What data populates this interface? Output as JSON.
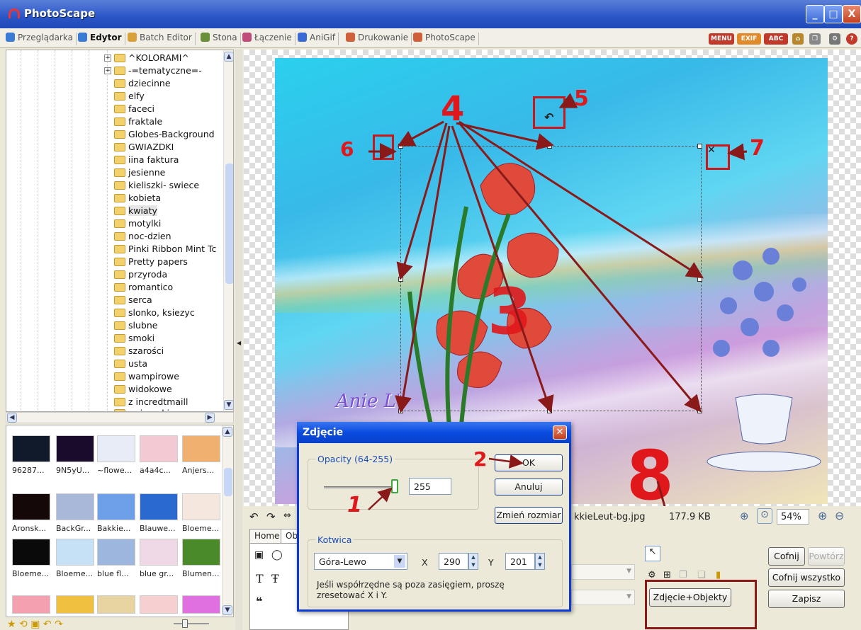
{
  "app": {
    "title": "PhotoScape"
  },
  "window_buttons": {
    "minimize": "_",
    "maximize": "□",
    "close": "X"
  },
  "tabs": [
    {
      "label": "Przeglądarka",
      "color": "#3a7bd5"
    },
    {
      "label": "Edytor",
      "color": "#3a7bd5"
    },
    {
      "label": "Batch Editor",
      "color": "#d9a13a"
    },
    {
      "label": "Stona",
      "color": "#6a8f3a"
    },
    {
      "label": "Łączenie",
      "color": "#c04a7a"
    },
    {
      "label": "AniGif",
      "color": "#3a6ad5"
    },
    {
      "label": "Drukowanie",
      "color": "#d0603a"
    },
    {
      "label": "PhotoScape",
      "color": "#d0603a"
    }
  ],
  "top_right_icons": {
    "menu": "MENU",
    "exif": "EXIF",
    "abc": "ABC"
  },
  "folders": [
    "^KOLORAMI^",
    "-=tematyczne=-",
    "dziecinne",
    "elfy",
    "faceci",
    "fraktale",
    "Globes-Background",
    "GWIAZDKI",
    "iina faktura",
    "jesienne",
    "kieliszki- swiece",
    "kobieta",
    "kwiaty",
    "motylki",
    "noc-dzien",
    "Pinki Ribbon Mint Tc",
    "Pretty papers",
    "przyroda",
    "romantico",
    "serca",
    "slonko, ksiezyc",
    "slubne",
    "smoki",
    "szarości",
    "usta",
    "wampirowe",
    "widokowe",
    "z incredtmaill",
    "zwierzaki"
  ],
  "selected_folder": "kwiaty",
  "thumbnails": [
    {
      "label": "96287...",
      "color": "#111a2a"
    },
    {
      "label": "9N5yU...",
      "color": "#1a0b2a"
    },
    {
      "label": "~flowe...",
      "color": "#e8ecf6"
    },
    {
      "label": "a4a4c...",
      "color": "#f3c9d4"
    },
    {
      "label": "Anjers...",
      "color": "#f0b070"
    },
    {
      "label": "Aronsk...",
      "color": "#140808"
    },
    {
      "label": "BackGr...",
      "color": "#a9b8d8"
    },
    {
      "label": "Bakkie...",
      "color": "#6da0e8"
    },
    {
      "label": "Blauwe...",
      "color": "#2a6ad0"
    },
    {
      "label": "Bloeme...",
      "color": "#f5e6de"
    },
    {
      "label": "Bloeme...",
      "color": "#0a0a0a"
    },
    {
      "label": "Bloeme...",
      "color": "#c6e0f5"
    },
    {
      "label": "blue fl...",
      "color": "#9cb6de"
    },
    {
      "label": "blue gr...",
      "color": "#f0d9e6"
    },
    {
      "label": "Blumen...",
      "color": "#4a8a2a"
    },
    {
      "label": "",
      "color": "#f4a0b0"
    },
    {
      "label": "",
      "color": "#f0c040"
    },
    {
      "label": "",
      "color": "#e8d4a0"
    },
    {
      "label": "",
      "color": "#f6d0d0"
    },
    {
      "label": "",
      "color": "#e070e0"
    }
  ],
  "canvas": {
    "signature": "Anie L'"
  },
  "annotations": {
    "n1": "1",
    "n2": "2",
    "n3": "3",
    "n4": "4",
    "n5": "5",
    "n6": "6",
    "n7": "7",
    "n8": "8"
  },
  "toolbar": {
    "filename": "kkieLeut-bg.jpg",
    "filesize": "177.9 KB",
    "zoom": "54%"
  },
  "editor_tabs": [
    "Home",
    "Ob"
  ],
  "editor_buttons": {
    "undo": "Cofnij",
    "redo": "Powtórz",
    "undo_all": "Cofnij wszystko",
    "save": "Zapisz",
    "photo_objects": "Zdjęcie+Objekty"
  },
  "dialog": {
    "title": "Zdjęcie",
    "opacity_label": "Opacity (64-255)",
    "opacity_value": "255",
    "opacity_level": 1.0,
    "ok": "OK",
    "cancel": "Anuluj",
    "resize": "Zmień rozmiar",
    "anchor_label": "Kotwica",
    "anchor_value": "Góra-Lewo",
    "x_label": "X",
    "x_value": "290",
    "y_label": "Y",
    "y_value": "201",
    "note": "Jeśli współrzędne są poza zasięgiem, proszę zresetować X i Y."
  }
}
